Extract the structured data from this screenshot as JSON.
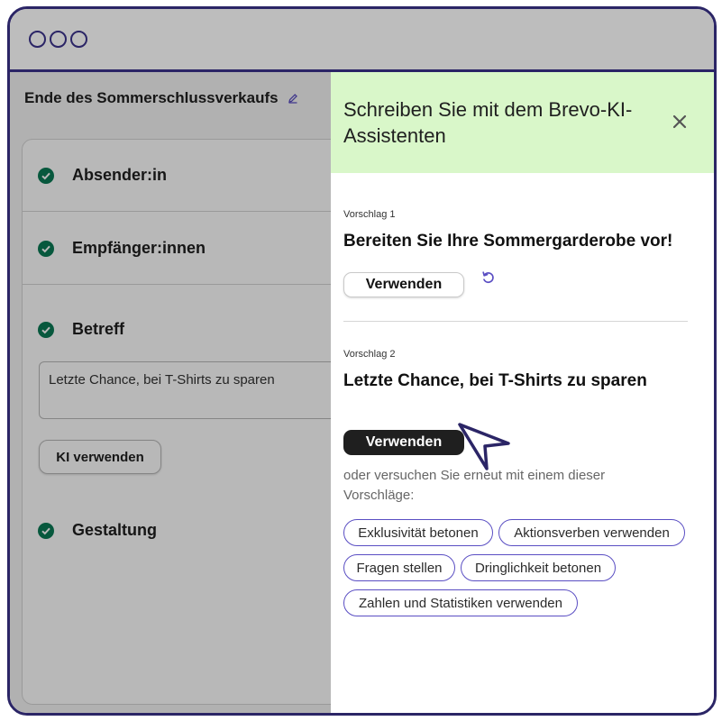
{
  "window": {
    "controls": [
      "window-dot",
      "window-dot",
      "window-dot"
    ]
  },
  "campaign": {
    "title": "Ende des Sommerschlussverkaufs",
    "steps": [
      "Absender:in",
      "Empfänger:innen",
      "Betreff",
      "Gestaltung"
    ],
    "subject_value": "Letzte Chance, bei T-Shirts zu sparen",
    "ki_button": "KI verwenden"
  },
  "assistant": {
    "title": "Schreiben Sie mit dem Brevo-KI-Assistenten",
    "suggestion1_label": "Vorschlag 1",
    "suggestion1_text": "Bereiten Sie Ihre Sommergarderobe vor!",
    "suggestion2_label": "Vorschlag 2",
    "suggestion2_text": "Letzte Chance, bei T-Shirts zu sparen",
    "use_label": "Verwenden",
    "hint": "oder versuchen Sie erneut mit einem dieser Vorschläge:",
    "chips": [
      "Exklusivität betonen",
      "Aktionsverben verwenden",
      "Fragen stellen",
      "Dringlichkeit betonen",
      "Zahlen und Statistiken verwenden"
    ]
  },
  "colors": {
    "frame": "#2b2566",
    "panel_header": "#d9f7c9",
    "check": "#0b7a55",
    "accent": "#5a4ec3"
  },
  "icons": {
    "close": "close-icon",
    "refresh": "refresh-icon",
    "edit": "pencil-icon",
    "check": "check-circle-icon",
    "cursor": "cursor-arrow-icon"
  }
}
